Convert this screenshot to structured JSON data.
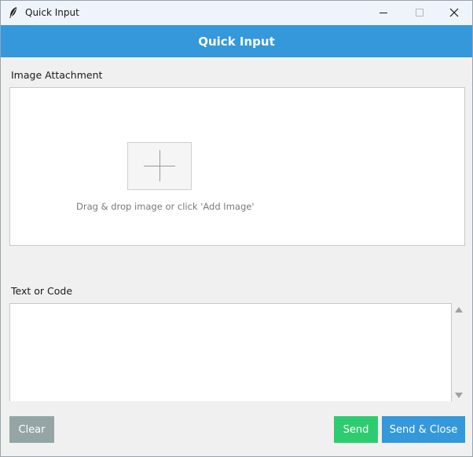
{
  "window": {
    "title": "Quick Input",
    "icon": "feather-icon",
    "controls": [
      "minimize-icon",
      "maximize-icon",
      "close-icon"
    ]
  },
  "header": {
    "title": "Quick Input",
    "color": "#3498db"
  },
  "image_section": {
    "label": "Image Attachment",
    "add_icon": "plus-icon",
    "hint": "Drag & drop image or click 'Add Image'"
  },
  "text_section": {
    "label": "Text or Code",
    "value": ""
  },
  "buttons": {
    "clear": "Clear",
    "send": "Send",
    "send_close": "Send & Close",
    "clear_color": "#95a5a6",
    "send_color": "#2ecc71",
    "send_close_color": "#3498db"
  }
}
